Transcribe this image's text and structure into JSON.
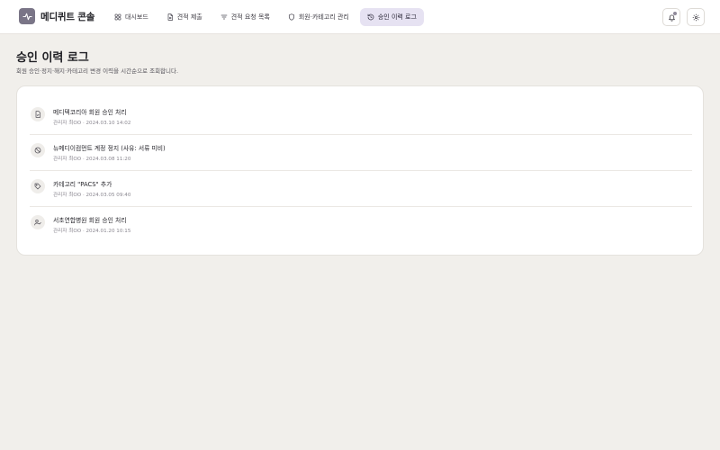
{
  "app": {
    "name": "메디퀴트 콘솔"
  },
  "nav": [
    {
      "label": "대시보드",
      "icon": "grid-icon",
      "active": false
    },
    {
      "label": "견적 제출",
      "icon": "document-icon",
      "active": false
    },
    {
      "label": "견적 요청 목록",
      "icon": "filter-icon",
      "active": false
    },
    {
      "label": "회원·카테고리 관리",
      "icon": "shield-icon",
      "active": false
    },
    {
      "label": "승인 이력 로그",
      "icon": "history-icon",
      "active": true
    }
  ],
  "header_actions": {
    "notifications_icon": "bell-icon",
    "settings_icon": "gear-icon"
  },
  "page": {
    "title": "승인 이력 로그",
    "subtitle": "회원 승인·정지·해지·카테고리 변경 이력을 시간순으로 조회합니다."
  },
  "logs": [
    {
      "icon": "file-check-icon",
      "title": "메디텍코리아 회원 승인 처리",
      "meta": "관리자 최OO · 2024.03.10 14:02"
    },
    {
      "icon": "ban-icon",
      "title": "뉴메디이컴먼트 계정 정지 (사유: 서류 미비)",
      "meta": "관리자 최OO · 2024.03.08 11:20"
    },
    {
      "icon": "tag-icon",
      "title": "카테고리 \"PACS\" 추가",
      "meta": "관리자 최OO · 2024.03.05 09:40"
    },
    {
      "icon": "user-check-icon",
      "title": "서초연합병원 회원 승인 처리",
      "meta": "관리자 최OO · 2024.01.20 10:15"
    }
  ],
  "colors": {
    "accent": "#7a7587",
    "active_nav_bg": "#e6e2f2",
    "background": "#f1efeb"
  }
}
